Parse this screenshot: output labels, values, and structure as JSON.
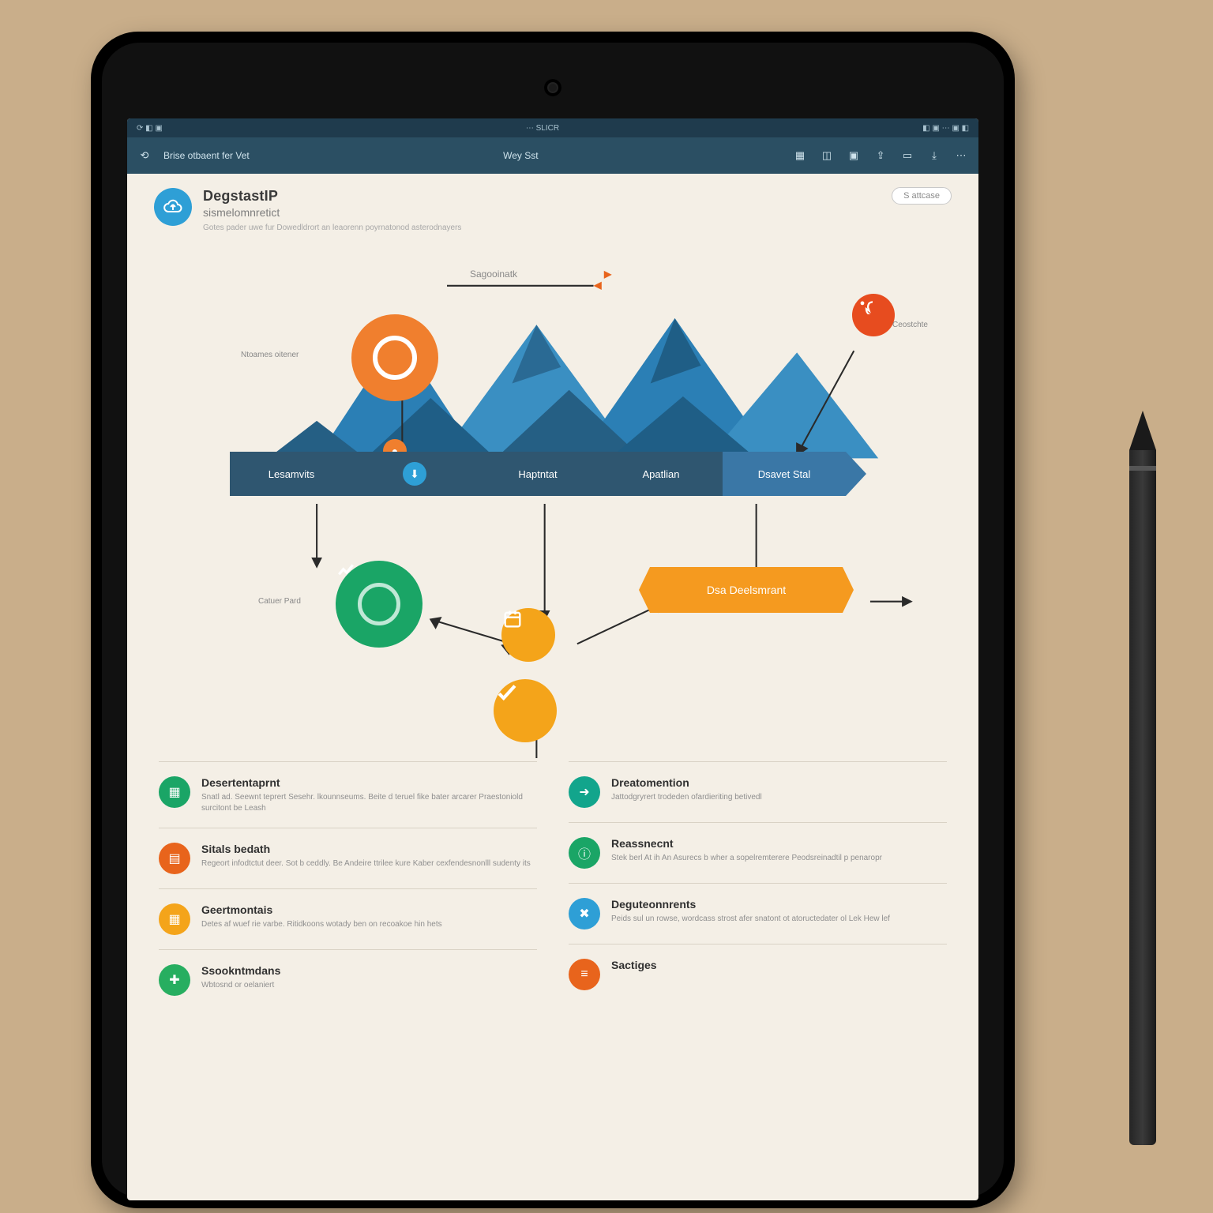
{
  "status": {
    "left": "⟳  ◧  ▣",
    "center": "⋯ SLICR",
    "right": "◧ ▣ ⋯ ▣ ◧"
  },
  "toolbar": {
    "title": "Brise otbaent fer Vet",
    "center": "Wey Sst",
    "icons": [
      "grid-icon",
      "refresh-icon",
      "layers-icon",
      "export-icon",
      "bookmark-icon",
      "download-icon",
      "more-icon"
    ]
  },
  "header": {
    "title": "DegstastIP",
    "subtitle": "sismelomnretict",
    "desc": "Gotes pader uwe fur Dowedldrort an leaorenn poyrnatonod asterodnayers",
    "button": "S attcase"
  },
  "diagram": {
    "topLabel": "Sagooinatk",
    "leftLabel": "Ntoames oitener",
    "rightLabel": "Ceostchte",
    "bottomLeftLabel": "Catuer Pard",
    "bar": [
      "Lesamvits",
      "",
      "Haptntat",
      "Apatlian",
      "Dsavet Stal"
    ],
    "block": "Dsa Deelsmrant"
  },
  "left": [
    {
      "t": "Desertentaprnt",
      "d": "Snatl ad. Seewnt teprert Sesehr. lkounnseums. Beite d teruel fike bater arcarer Praestoniold surcitont be Leash",
      "c": "c-green",
      "i": "▦"
    },
    {
      "t": "Sitals bedath",
      "d": "Regeort infodtctut deer. Sot b ceddly. Be Andeire ttrilee kure Kaber cexfendesnonlll sudenty its",
      "c": "c-orange",
      "i": "▤"
    },
    {
      "t": "Geertmontais",
      "d": "Detes af wuef rie varbe. Ritidkoons wotady ben on recoakoe hin hets",
      "c": "c-amber",
      "i": "▦"
    },
    {
      "t": "Ssookntmdans",
      "d": "Wbtosnd or oelaniert",
      "c": "c-green2",
      "i": "✚"
    }
  ],
  "right": [
    {
      "t": "Dreatomention",
      "d": "Jattodgryrert trodeden ofardieriting betivedl",
      "c": "c-teal",
      "i": "➜"
    },
    {
      "t": "Reassnecnt",
      "d": "Stek berl At ih An Asurecs b wher a sopelremterere Peodsreinadtil p penaropr",
      "c": "c-green",
      "i": "ⓘ"
    },
    {
      "t": "Deguteonnrents",
      "d": "Peids sul un rowse, wordcass strost afer snatont ot atoructedater ol Lek Hew lef",
      "c": "c-blue",
      "i": "✖"
    },
    {
      "t": "Sactiges",
      "d": "",
      "c": "c-orange",
      "i": "≡"
    }
  ],
  "colors": {
    "accent": "#2b4f63"
  }
}
